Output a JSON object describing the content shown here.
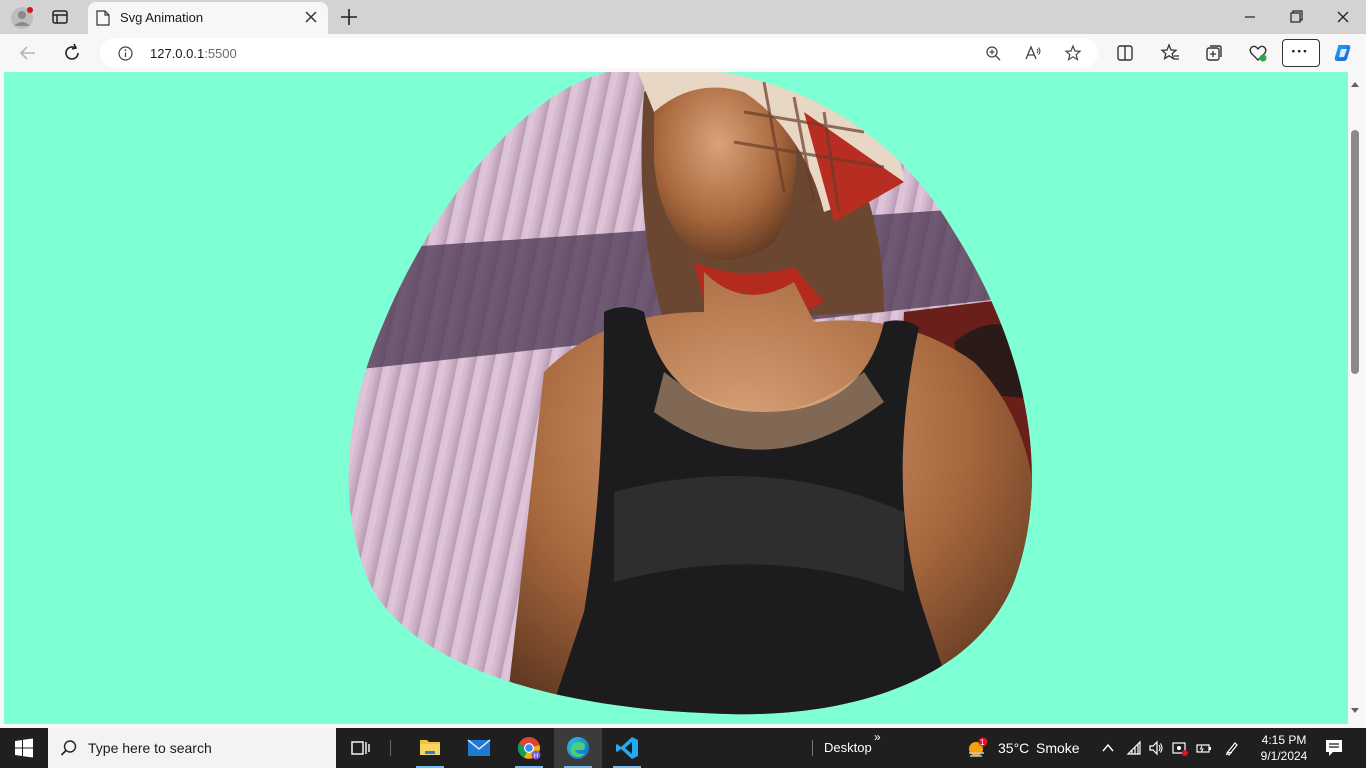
{
  "browser": {
    "tab": {
      "title": "Svg Animation"
    },
    "address": {
      "host": "127.0.0.1",
      "port": ":5500"
    }
  },
  "page": {
    "background_color": "#7fffd4",
    "image": "woman-in-plaid-headscarf-and-black-tank-top"
  },
  "taskbar": {
    "search_placeholder": "Type here to search",
    "desktop_label": "Desktop",
    "weather": {
      "temp": "35°C",
      "condition": "Smoke",
      "badge": "1"
    },
    "clock": {
      "time": "4:15 PM",
      "date": "9/1/2024"
    },
    "apps": [
      "file-explorer",
      "mail",
      "chrome",
      "edge",
      "vscode"
    ]
  }
}
